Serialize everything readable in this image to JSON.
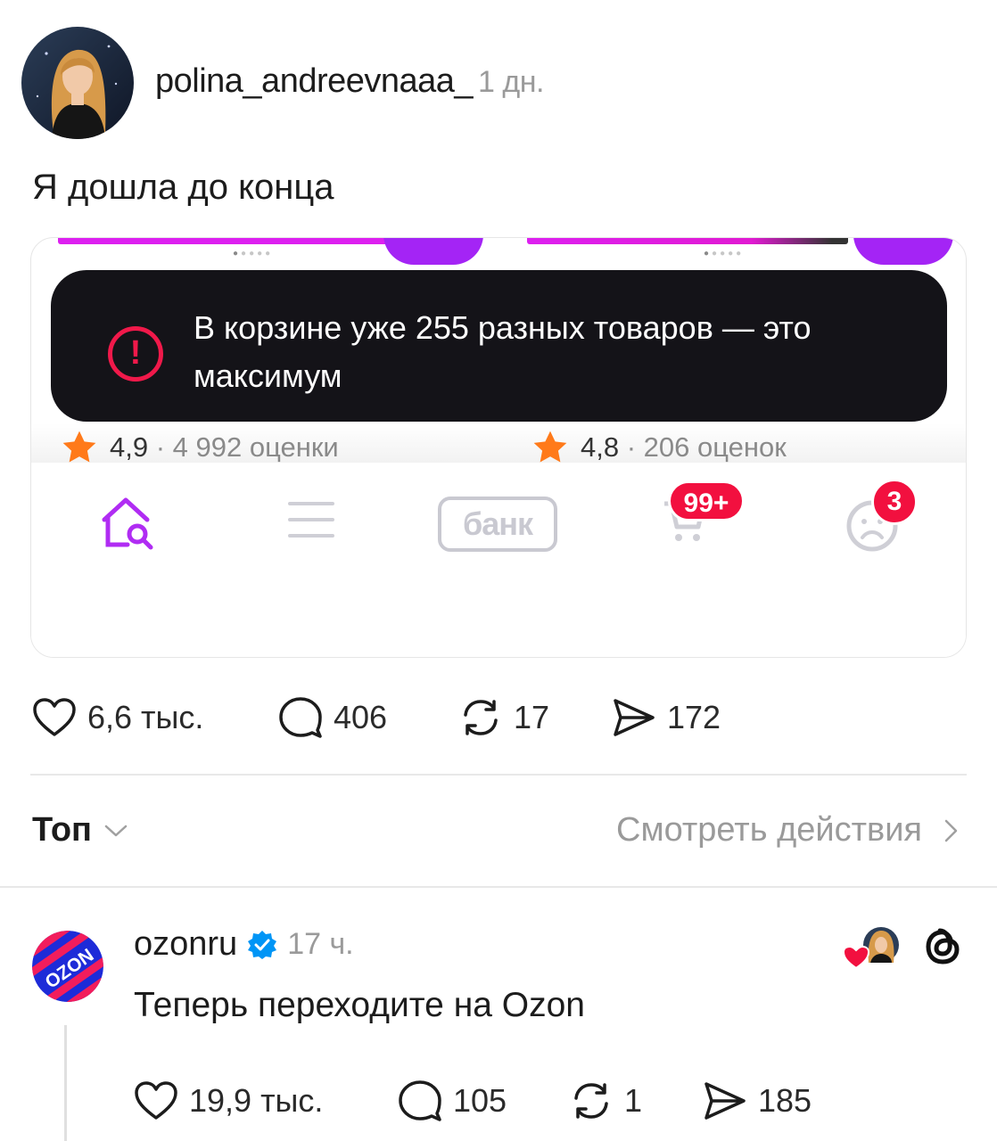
{
  "post": {
    "username": "polina_andreevnaaa_",
    "time": "1 дн.",
    "text": "Я дошла до конца"
  },
  "embedded_screenshot": {
    "toast_text": "В корзине уже 255 разных товаров — это максимум",
    "products": [
      {
        "rating": "4,9",
        "reviews": "· 4 992 оценки"
      },
      {
        "rating": "4,8",
        "reviews": "· 206 оценок"
      }
    ],
    "tabbar": {
      "bank_label": "банк",
      "cart_badge": "99+",
      "profile_badge": "3"
    },
    "accent_color": "#a424f5",
    "badge_color": "#f2103f"
  },
  "post_actions": {
    "likes": "6,6 тыс.",
    "comments": "406",
    "reposts": "17",
    "shares": "172"
  },
  "sort": {
    "label": "Топ",
    "activity_link": "Смотреть действия"
  },
  "reply": {
    "username": "ozonru",
    "time": "17 ч.",
    "text": "Теперь переходите на Ozon",
    "avatar_text": "OZON",
    "actions": {
      "likes": "19,9 тыс.",
      "comments": "105",
      "reposts": "1",
      "shares": "185"
    }
  }
}
